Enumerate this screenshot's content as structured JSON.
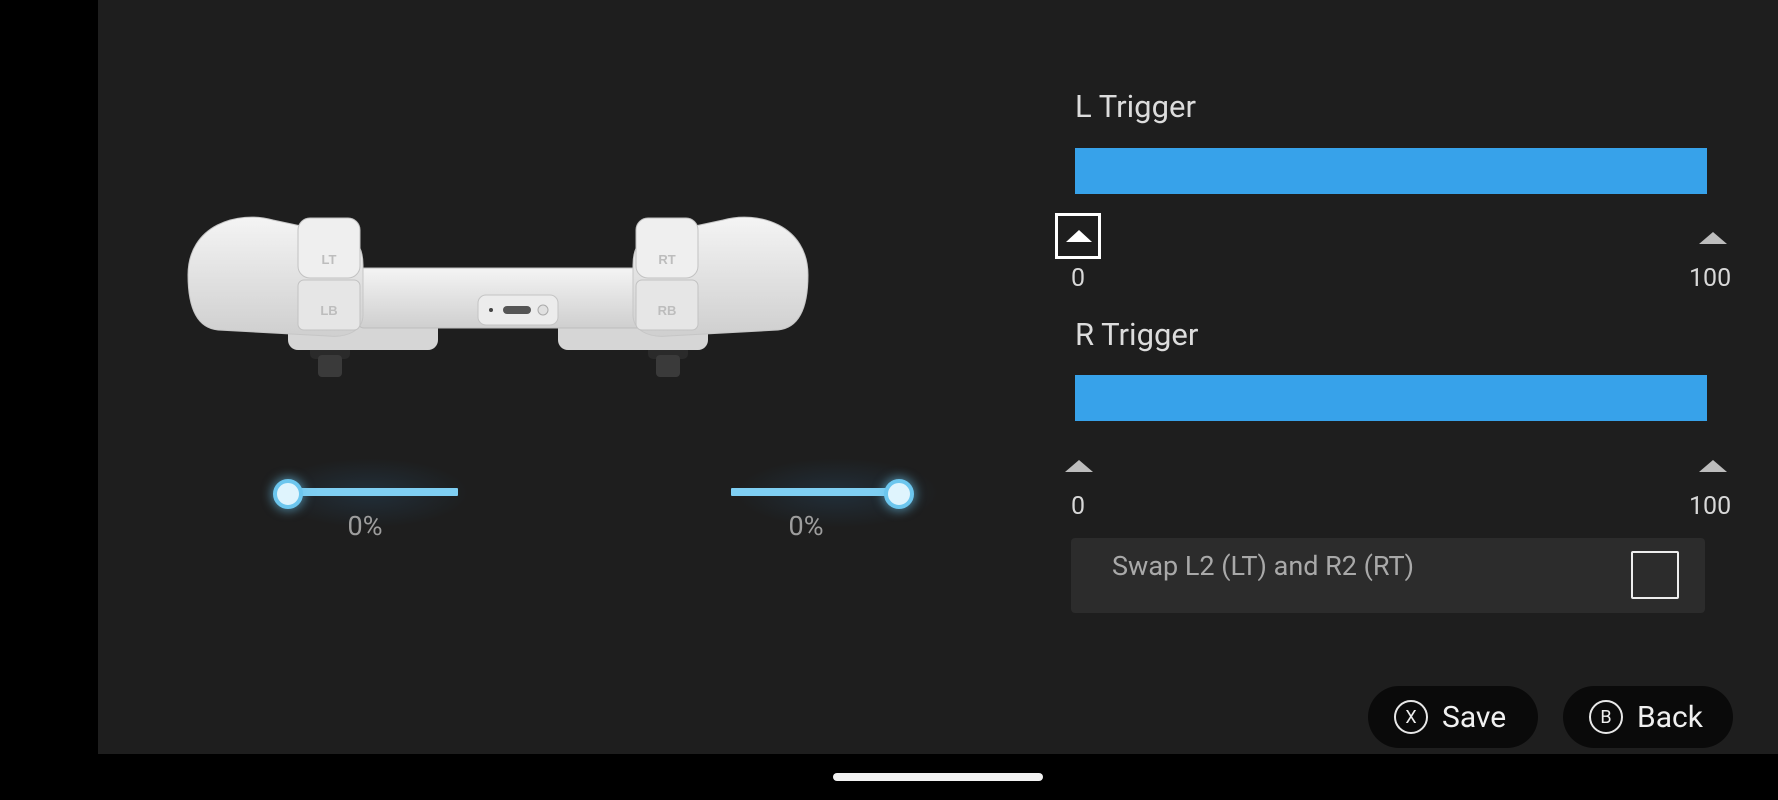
{
  "left_trigger": {
    "title": "L Trigger",
    "min_label": "0",
    "max_label": "100"
  },
  "right_trigger": {
    "title": "R Trigger",
    "min_label": "0",
    "max_label": "100"
  },
  "preview": {
    "left_percent": "0%",
    "right_percent": "0%",
    "left_level": 0,
    "right_level": 0
  },
  "controller": {
    "lt": "LT",
    "lb": "LB",
    "rt": "RT",
    "rb": "RB"
  },
  "swap": {
    "label": "Swap L2 (LT) and R2 (RT)",
    "checked": false
  },
  "buttons": {
    "save": {
      "glyph": "X",
      "label": "Save"
    },
    "back": {
      "glyph": "B",
      "label": "Back"
    }
  },
  "colors": {
    "bar": "#37a2ea",
    "preview_track": "#7fcff3",
    "panel_bg": "#1e1e1e"
  }
}
